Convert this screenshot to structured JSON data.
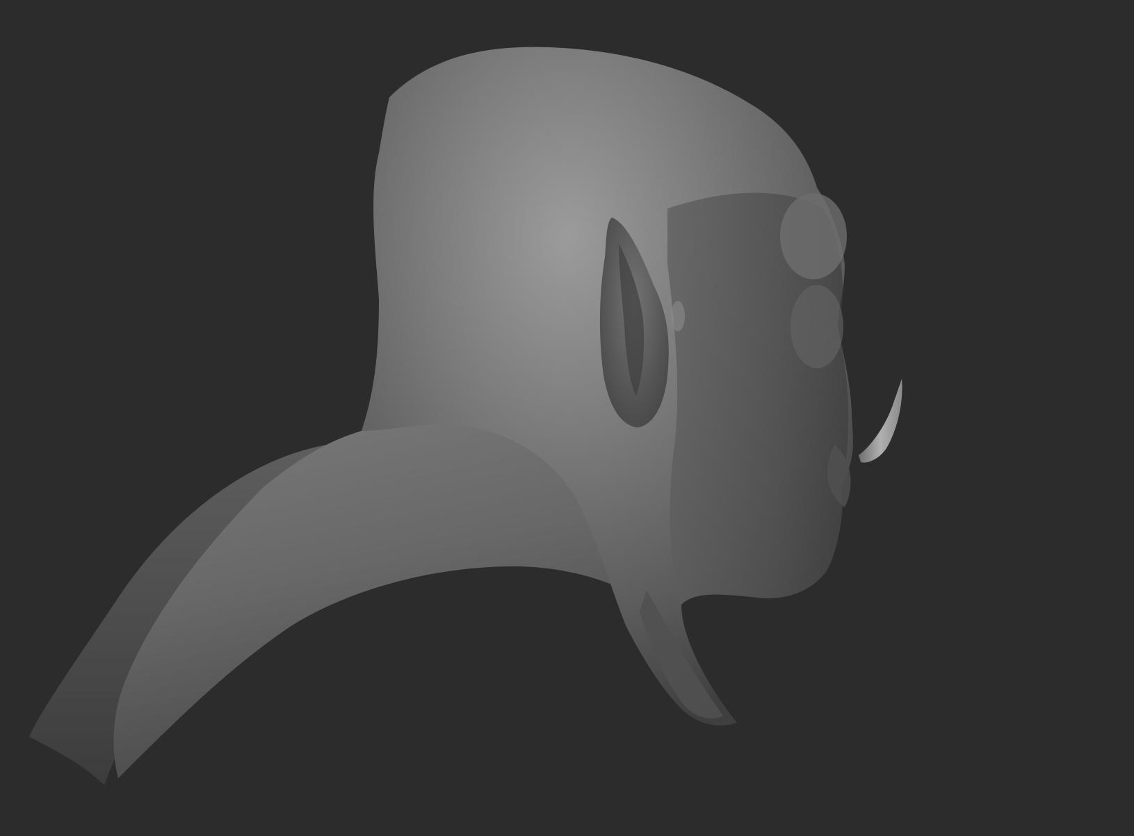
{
  "scene": {
    "background_color": "#2c2c2c",
    "model": {
      "subject": "orc-bust-sculpt",
      "material_color": "#7a7a7a",
      "features": [
        "bald-head",
        "pointed-ear",
        "tusk",
        "shoulder-shawl"
      ]
    }
  }
}
